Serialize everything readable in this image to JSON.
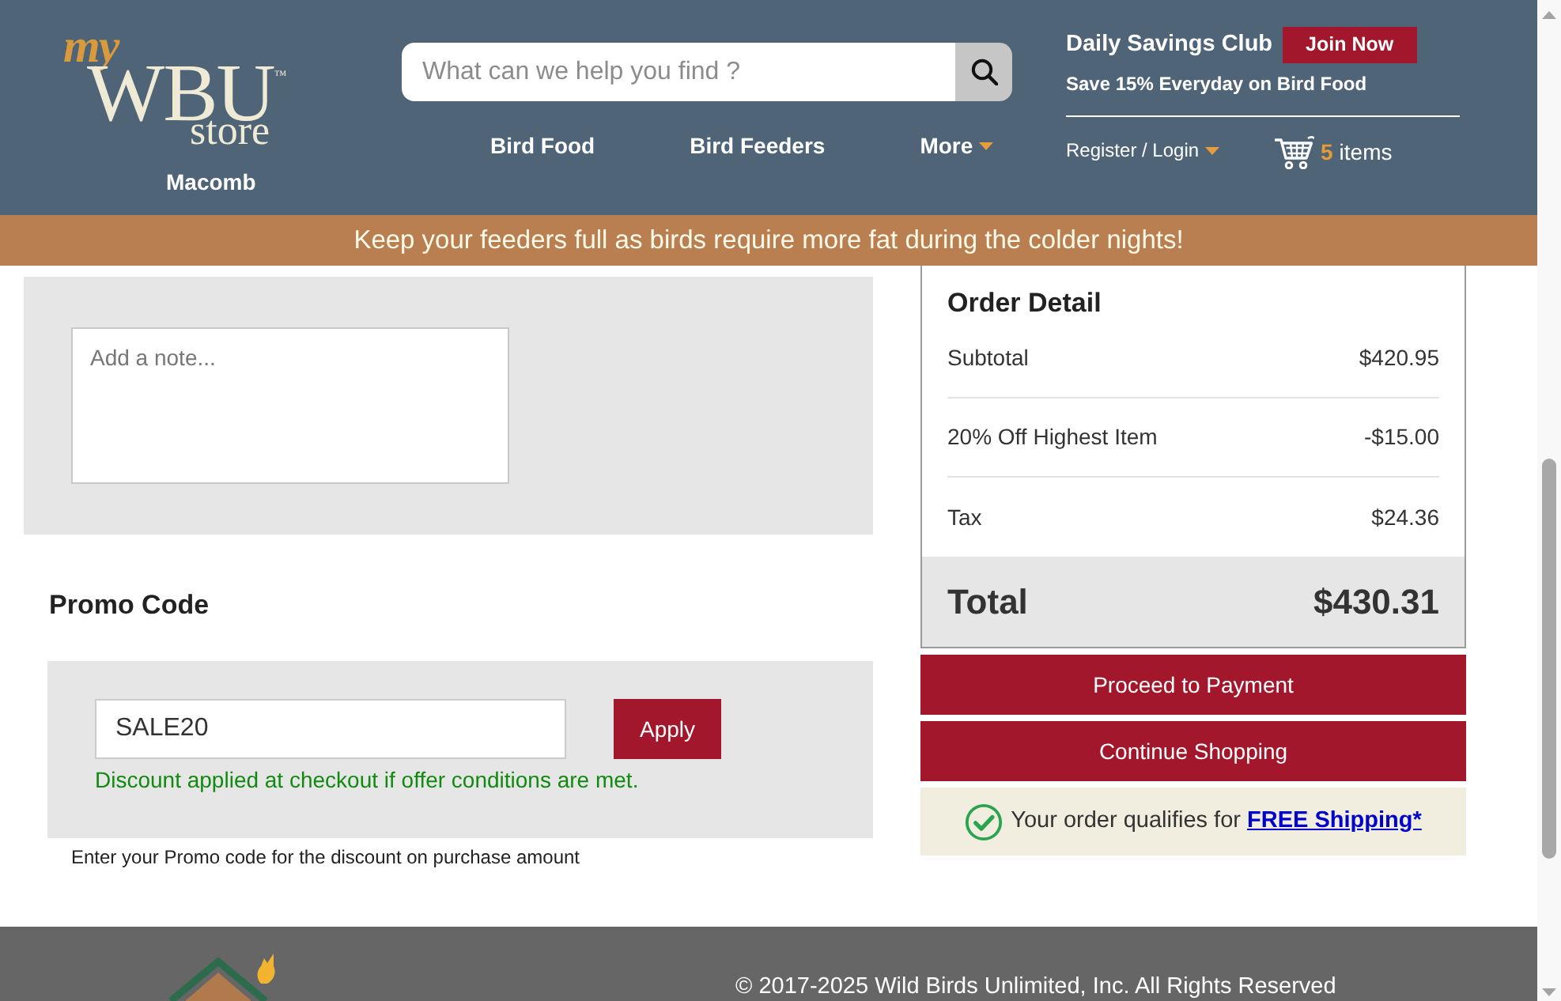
{
  "header": {
    "logo": {
      "script": "my",
      "wordmark": "WBU",
      "trademark": "™",
      "subtitle": "store"
    },
    "store_name": "Macomb",
    "search": {
      "placeholder": "What can we help you find ?"
    },
    "nav": [
      {
        "label": "Bird Food",
        "dropdown": false
      },
      {
        "label": "Bird Feeders",
        "dropdown": false
      },
      {
        "label": "More",
        "dropdown": true
      }
    ],
    "club": {
      "title": "Daily Savings Club",
      "button": "Join Now",
      "tagline": "Save 15% Everyday on Bird Food"
    },
    "account": {
      "label": "Register / Login",
      "dropdown": true
    },
    "cart": {
      "count": "5",
      "label": "items"
    }
  },
  "banner": {
    "text": "Keep your feeders full as birds require more fat during the colder nights!"
  },
  "note": {
    "placeholder": "Add a note..."
  },
  "promo": {
    "title": "Promo Code",
    "value": "SALE20",
    "button": "Apply",
    "message": "Discount applied at checkout if offer conditions are met.",
    "hint": "Enter your Promo code for the discount on purchase amount"
  },
  "order_detail": {
    "title": "Order Detail",
    "lines": [
      {
        "label": "Subtotal",
        "amount": "$420.95"
      },
      {
        "label": "20% Off Highest Item",
        "amount": "-$15.00"
      },
      {
        "label": "Tax",
        "amount": "$24.36"
      }
    ],
    "total": {
      "label": "Total",
      "amount": "$430.31"
    }
  },
  "actions": [
    {
      "label": "Proceed to Payment"
    },
    {
      "label": "Continue Shopping"
    }
  ],
  "shipping_notice": {
    "text": "Your order qualifies for",
    "link": "FREE Shipping*"
  },
  "footer": {
    "copyright": "© 2017-2025 Wild Birds Unlimited, Inc. All Rights Reserved"
  }
}
